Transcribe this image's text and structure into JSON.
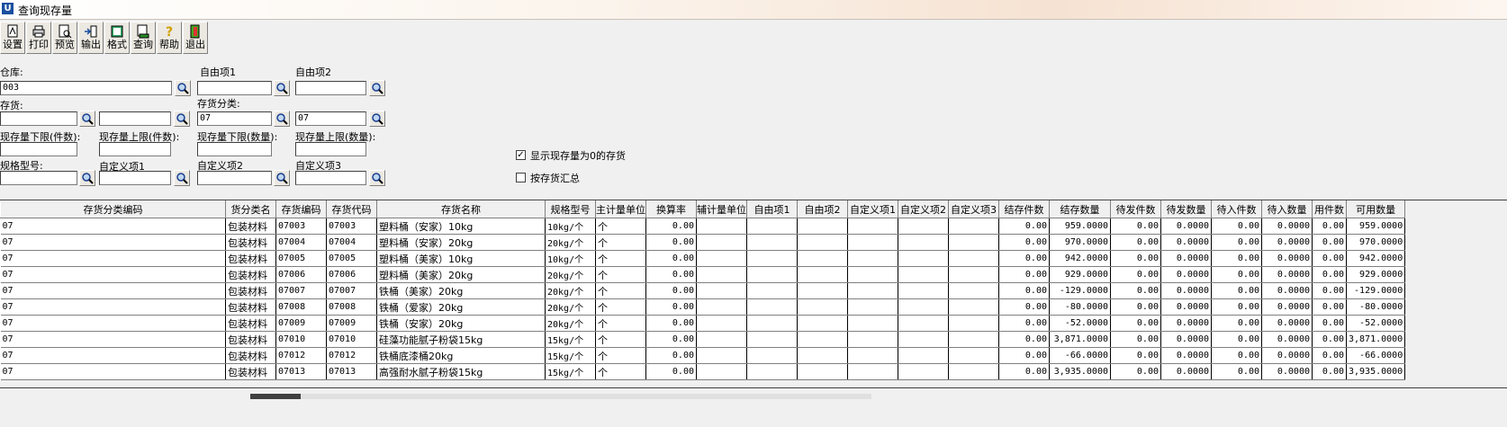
{
  "window": {
    "title": "查询现存量"
  },
  "toolbar": [
    {
      "label": "设置",
      "icon": "settings-icon"
    },
    {
      "label": "打印",
      "icon": "printer-icon"
    },
    {
      "label": "预览",
      "icon": "preview-icon"
    },
    {
      "label": "输出",
      "icon": "export-icon"
    },
    {
      "label": "格式",
      "icon": "format-icon"
    },
    {
      "label": "查询",
      "icon": "query-icon"
    },
    {
      "label": "帮助",
      "icon": "help-icon"
    },
    {
      "label": "退出",
      "icon": "exit-icon"
    }
  ],
  "filters": {
    "warehouse": {
      "label": "仓库:",
      "value": "003"
    },
    "custom1": {
      "label": "自由项1",
      "value": ""
    },
    "custom2": {
      "label": "自由项2",
      "value": ""
    },
    "inventory": {
      "label": "存货:",
      "value_from": "",
      "value_to": ""
    },
    "inventory_class": {
      "label": "存货分类:",
      "value_from": "07",
      "value_to": "07"
    },
    "qty_min_pieces": {
      "label": "现存量下限(件数):",
      "value": ""
    },
    "qty_max_pieces": {
      "label": "现存量上限(件数):",
      "value": ""
    },
    "qty_min_amount": {
      "label": "现存量下限(数量):",
      "value": ""
    },
    "qty_max_amount": {
      "label": "现存量上限(数量):",
      "value": ""
    },
    "spec": {
      "label": "规格型号:",
      "value": ""
    },
    "udf1": {
      "label": "自定义项1",
      "value": ""
    },
    "udf2": {
      "label": "自定义项2",
      "value": ""
    },
    "udf3": {
      "label": "自定义项3",
      "value": ""
    },
    "show_zero": {
      "label": "显示现存量为0的存货",
      "checked": true
    },
    "group_by_inventory": {
      "label": "按存货汇总",
      "checked": false
    }
  },
  "table": {
    "columns": [
      "存货分类编码",
      "货分类名",
      "存货编码",
      "存货代码",
      "存货名称",
      "规格型号",
      "主计量单位",
      "换算率",
      "辅计量单位",
      "自由项1",
      "自由项2",
      "自定义项1",
      "自定义项2",
      "自定义项3",
      "结存件数",
      "结存数量",
      "待发件数",
      "待发数量",
      "待入件数",
      "待入数量",
      "用件数",
      "可用数量"
    ],
    "rows": [
      [
        "07",
        "包装材料",
        "07003",
        "07003",
        "塑料桶（安家）10kg",
        "10kg/个",
        "个",
        "0.00",
        "",
        "",
        "",
        "",
        "",
        "",
        "0.00",
        "959.0000",
        "0.00",
        "0.0000",
        "0.00",
        "0.0000",
        "0.00",
        "959.0000"
      ],
      [
        "07",
        "包装材料",
        "07004",
        "07004",
        "塑料桶（安家）20kg",
        "20kg/个",
        "个",
        "0.00",
        "",
        "",
        "",
        "",
        "",
        "",
        "0.00",
        "970.0000",
        "0.00",
        "0.0000",
        "0.00",
        "0.0000",
        "0.00",
        "970.0000"
      ],
      [
        "07",
        "包装材料",
        "07005",
        "07005",
        "塑料桶（美家）10kg",
        "10kg/个",
        "个",
        "0.00",
        "",
        "",
        "",
        "",
        "",
        "",
        "0.00",
        "942.0000",
        "0.00",
        "0.0000",
        "0.00",
        "0.0000",
        "0.00",
        "942.0000"
      ],
      [
        "07",
        "包装材料",
        "07006",
        "07006",
        "塑料桶（美家）20kg",
        "20kg/个",
        "个",
        "0.00",
        "",
        "",
        "",
        "",
        "",
        "",
        "0.00",
        "929.0000",
        "0.00",
        "0.0000",
        "0.00",
        "0.0000",
        "0.00",
        "929.0000"
      ],
      [
        "07",
        "包装材料",
        "07007",
        "07007",
        "铁桶（美家）20kg",
        "20kg/个",
        "个",
        "0.00",
        "",
        "",
        "",
        "",
        "",
        "",
        "0.00",
        "-129.0000",
        "0.00",
        "0.0000",
        "0.00",
        "0.0000",
        "0.00",
        "-129.0000"
      ],
      [
        "07",
        "包装材料",
        "07008",
        "07008",
        "铁桶（爱家）20kg",
        "20kg/个",
        "个",
        "0.00",
        "",
        "",
        "",
        "",
        "",
        "",
        "0.00",
        "-80.0000",
        "0.00",
        "0.0000",
        "0.00",
        "0.0000",
        "0.00",
        "-80.0000"
      ],
      [
        "07",
        "包装材料",
        "07009",
        "07009",
        "铁桶（安家）20kg",
        "20kg/个",
        "个",
        "0.00",
        "",
        "",
        "",
        "",
        "",
        "",
        "0.00",
        "-52.0000",
        "0.00",
        "0.0000",
        "0.00",
        "0.0000",
        "0.00",
        "-52.0000"
      ],
      [
        "07",
        "包装材料",
        "07010",
        "07010",
        "硅藻功能腻子粉袋15kg",
        "15kg/个",
        "个",
        "0.00",
        "",
        "",
        "",
        "",
        "",
        "",
        "0.00",
        "3,871.0000",
        "0.00",
        "0.0000",
        "0.00",
        "0.0000",
        "0.00",
        "3,871.0000"
      ],
      [
        "07",
        "包装材料",
        "07012",
        "07012",
        "铁桶底漆桶20kg",
        "15kg/个",
        "个",
        "0.00",
        "",
        "",
        "",
        "",
        "",
        "",
        "0.00",
        "-66.0000",
        "0.00",
        "0.0000",
        "0.00",
        "0.0000",
        "0.00",
        "-66.0000"
      ],
      [
        "07",
        "包装材料",
        "07013",
        "07013",
        "高强耐水腻子粉袋15kg",
        "15kg/个",
        "个",
        "0.00",
        "",
        "",
        "",
        "",
        "",
        "",
        "0.00",
        "3,935.0000",
        "0.00",
        "0.0000",
        "0.00",
        "0.0000",
        "0.00",
        "3,935.0000"
      ]
    ]
  }
}
